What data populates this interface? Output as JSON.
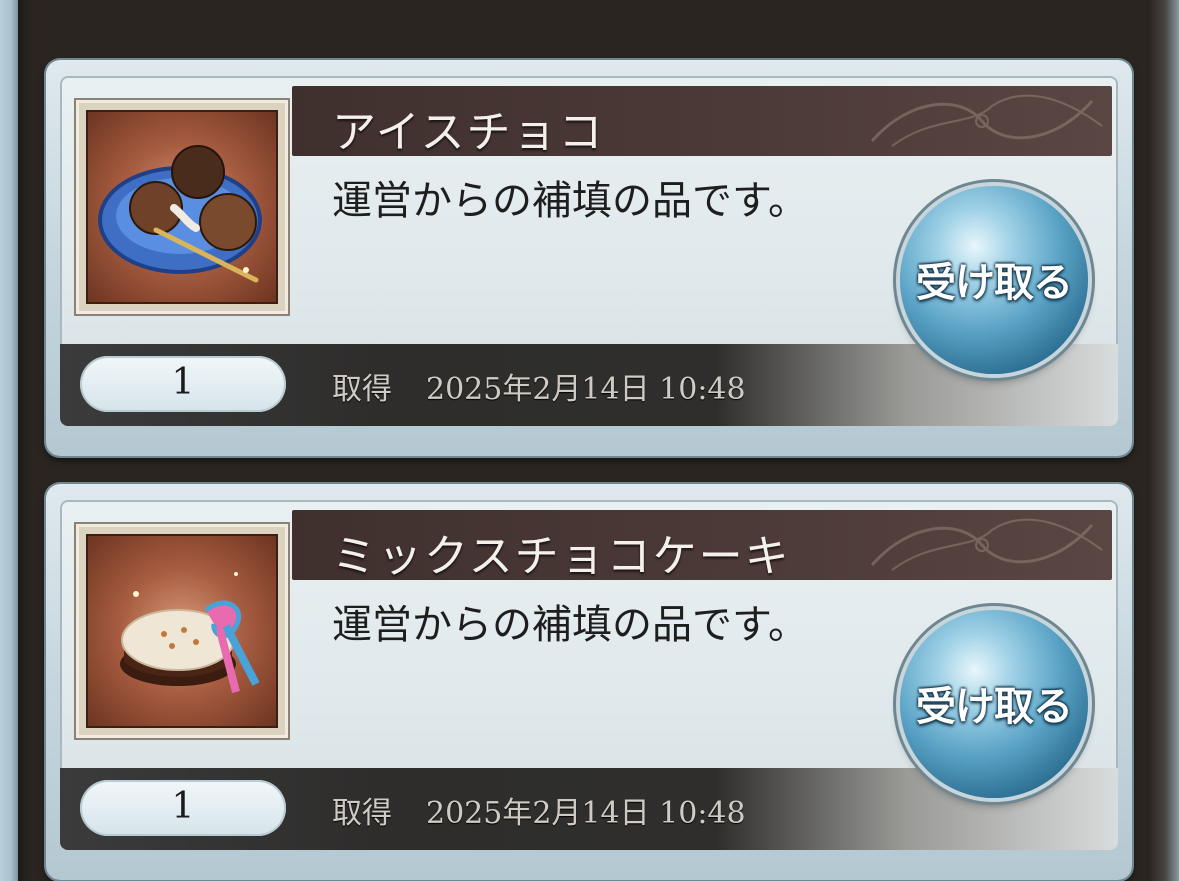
{
  "rewards": [
    {
      "name": "アイスチョコ",
      "description": "運営からの補填の品です。",
      "quantity": "1",
      "acquired_label": "取得",
      "acquired_date": "2025年2月14日 10:48",
      "claim_label": "受け取る",
      "icon": "ice-chocolate-icon"
    },
    {
      "name": "ミックスチョコケーキ",
      "description": "運営からの補填の品です。",
      "quantity": "1",
      "acquired_label": "取得",
      "acquired_date": "2025年2月14日 10:48",
      "claim_label": "受け取る",
      "icon": "mixed-chocolate-cake-icon"
    }
  ],
  "colors": {
    "name_band": "#4c3a37",
    "claim_button": "#5aa3c6",
    "card": "#dfe8eb"
  }
}
